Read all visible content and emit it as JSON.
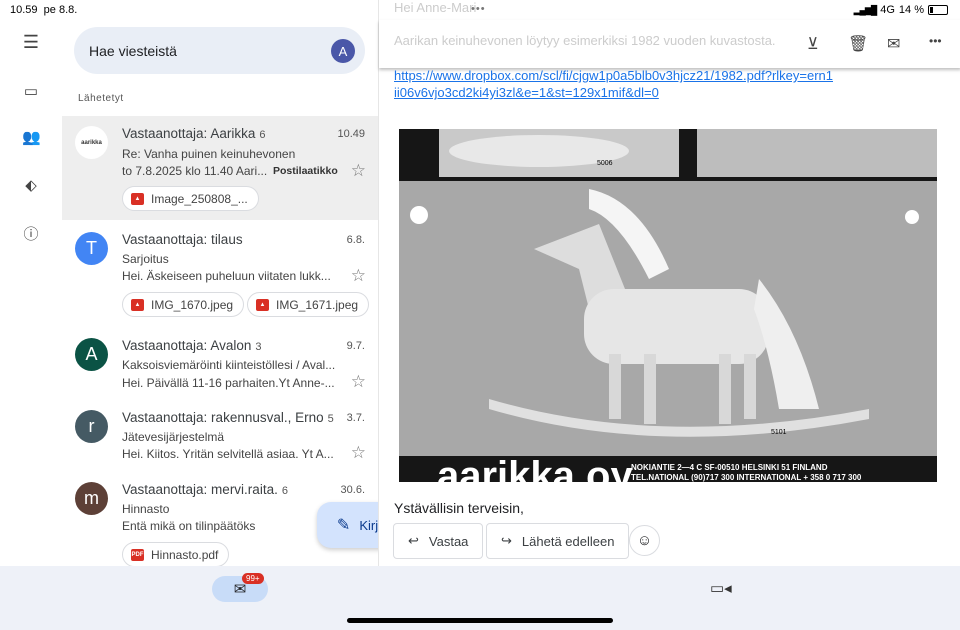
{
  "status": {
    "time": "10.59",
    "date": "pe 8.8.",
    "network": "4G",
    "battery": "14 %"
  },
  "search": {
    "placeholder": "Hae viesteistä",
    "avatar": "A"
  },
  "section": "Lähetetyt",
  "messages": [
    {
      "avatar": "aarikka",
      "avatar_color": "#ffffff",
      "from": "Vastaanottaja: Aarikka",
      "count": "6",
      "date": "10.49",
      "subject": "Re: Vanha puinen keinuhevonen",
      "snippet": "to 7.8.2025 klo 11.40 Aari...",
      "label": "Postilaatikko",
      "attachments": [
        "Image_250808_..."
      ],
      "selected": true
    },
    {
      "avatar": "T",
      "avatar_color": "#4285f4",
      "from": "Vastaanottaja: tilaus",
      "count": "",
      "date": "6.8.",
      "subject": "Sarjoitus",
      "snippet": "Hei. Äskeiseen puheluun viitaten lukk...",
      "attachments": [
        "IMG_1670.jpeg",
        "IMG_1671.jpeg"
      ]
    },
    {
      "avatar": "A",
      "avatar_color": "#0b5345",
      "from": "Vastaanottaja: Avalon",
      "count": "3",
      "date": "9.7.",
      "subject": "Kaksoisviemäröinti kiinteistöllesi / Aval...",
      "snippet": "Hei. Päivällä 11-16 parhaiten.Yt Anne-..."
    },
    {
      "avatar": "r",
      "avatar_color": "#455a64",
      "from": "Vastaanottaja: rakennusval., Erno",
      "count": "5",
      "date": "3.7.",
      "subject": "Jätevesijärjestelmä",
      "snippet": "Hei. Kiitos. Yritän selvitellä asiaa. Yt A..."
    },
    {
      "avatar": "m",
      "avatar_color": "#5d4037",
      "from": "Vastaanottaja: mervi.raita.",
      "count": "6",
      "date": "30.6.",
      "subject": "Hinnasto",
      "snippet": "Entä mikä on tilinpäätöks",
      "attachments": [
        "Hinnasto.pdf"
      ]
    }
  ],
  "compose": "Kirjoita",
  "reader": {
    "greeting": "Hei Anne-Mari",
    "line1": "Aarikan keinuhevonen löytyy esimerkiksi 1982 vuoden kuvastosta.",
    "link": "https://www.dropbox.com/scl/fi/cjgw1p0a5blb0v3hjcz21/1982.pdf?rlkey=ern1ii06v6vjo3cd2ki4yi3zl&e=1&st=129x1mif&dl=0",
    "image": {
      "brand": "aarikka oy",
      "address": "NOKIANTIE 2—4 C SF-00510 HELSINKI 51 FINLAND",
      "phone": "TEL.NATIONAL (90)717 300 INTERNATIONAL + 358 0 717 300",
      "code_top": "5006",
      "code_horse": "5101"
    },
    "signoff": "Ystävällisin terveisin,",
    "reply": "Vastaa",
    "forward": "Lähetä edelleen"
  },
  "bottom": {
    "unread": "99+"
  }
}
